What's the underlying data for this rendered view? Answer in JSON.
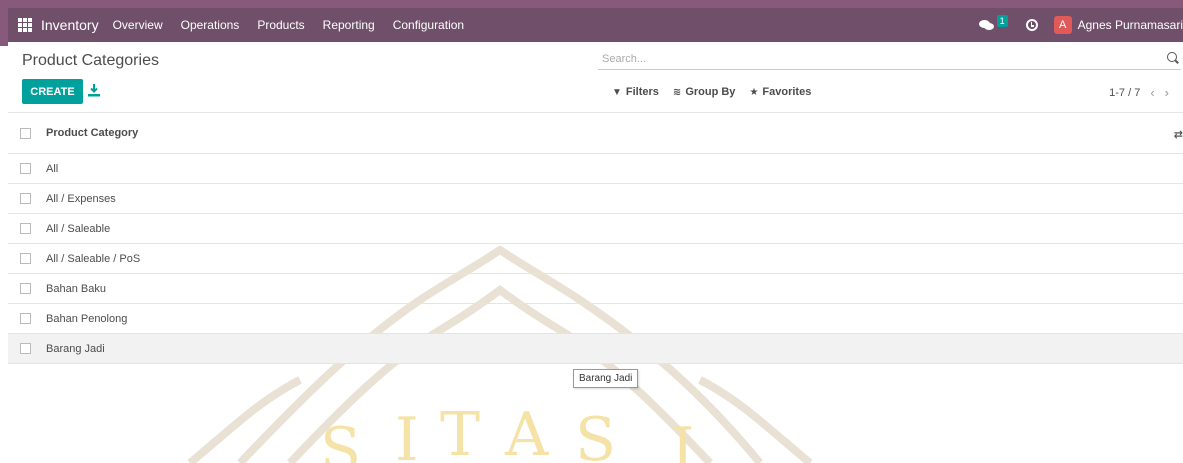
{
  "navbar": {
    "app_name": "Inventory",
    "menu": [
      "Overview",
      "Operations",
      "Products",
      "Reporting",
      "Configuration"
    ],
    "chat_badge": "1",
    "avatar_letter": "A",
    "user_name": "Agnes Purnamasari"
  },
  "control_panel": {
    "title": "Product Categories",
    "create_label": "CREATE",
    "search_placeholder": "Search...",
    "filters_label": "Filters",
    "group_by_label": "Group By",
    "favorites_label": "Favorites",
    "pager": "1-7 / 7"
  },
  "list": {
    "header": "Product Category",
    "rows": [
      "All",
      "All / Expenses",
      "All / Saleable",
      "All / Saleable / PoS",
      "Bahan Baku",
      "Bahan Penolong",
      "Barang Jadi"
    ]
  },
  "tooltip": "Barang Jadi",
  "colors": {
    "navbar": "#875a7b",
    "topbar": "#6f4f69",
    "accent": "#00a09d",
    "watermark": "#f4e2a6"
  }
}
